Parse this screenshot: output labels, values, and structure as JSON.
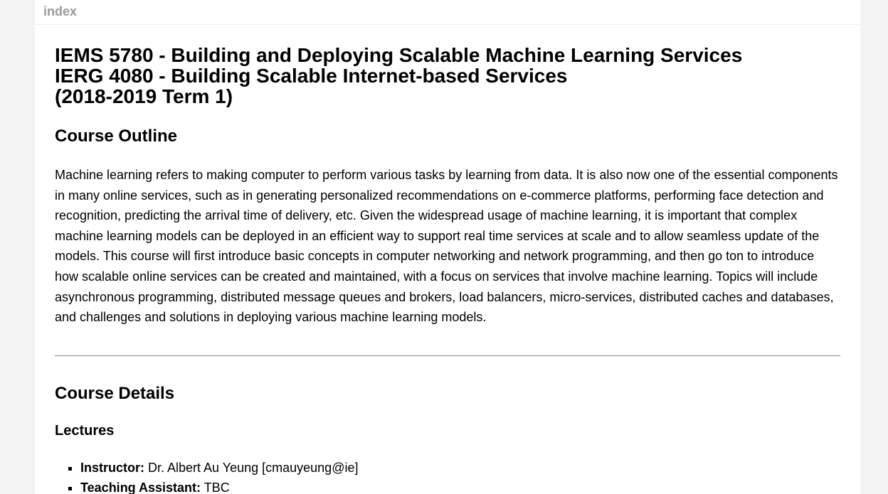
{
  "topbar": {
    "index_link": "index"
  },
  "course": {
    "title_line1": "IEMS 5780 - Building and Deploying Scalable Machine Learning Services",
    "title_line2": "IERG 4080 - Building Scalable Internet-based Services",
    "title_line3": "(2018-2019 Term 1)"
  },
  "outline": {
    "heading": "Course Outline",
    "text": "Machine learning refers to making computer to perform various tasks by learning from data. It is also now one of the essential components in many online services, such as in generating personalized recommendations on e-commerce platforms, performing face detection and recognition, predicting the arrival time of delivery, etc. Given the widespread usage of machine learning, it is important that complex machine learning models can be deployed in an efficient way to support real time services at scale and to allow seamless update of the models. This course will first introduce basic concepts in computer networking and network programming, and then go ton to introduce how scalable online services can be created and maintained, with a focus on services that involve machine learning. Topics will include asynchronous programming, distributed message queues and brokers, load balancers, micro-services, distributed caches and databases, and challenges and solutions in deploying various machine learning models."
  },
  "details": {
    "heading": "Course Details",
    "lectures_heading": "Lectures",
    "staff": [
      {
        "label": "Instructor:",
        "value": " Dr. Albert Au Yeung [cmauyeung@ie]"
      },
      {
        "label": "Teaching Assistant:",
        "value": " TBC"
      }
    ]
  }
}
